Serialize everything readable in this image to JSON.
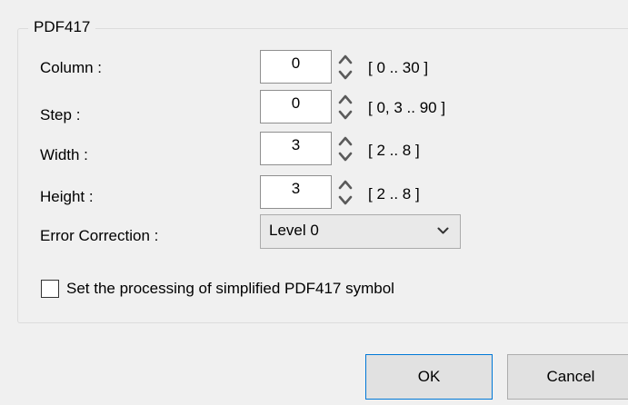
{
  "group": {
    "title": "PDF417"
  },
  "fields": {
    "column": {
      "label": "Column :",
      "value": "0",
      "range": "[ 0 .. 30 ]"
    },
    "step": {
      "label": "Step :",
      "value": "0",
      "range": "[ 0, 3 .. 90 ]"
    },
    "width": {
      "label": "Width :",
      "value": "3",
      "range": "[ 2 .. 8 ]"
    },
    "height": {
      "label": "Height :",
      "value": "3",
      "range": "[ 2 .. 8 ]"
    }
  },
  "error_correction": {
    "label": "Error Correction :",
    "selected": "Level 0"
  },
  "checkbox": {
    "label": "Set the processing of simplified PDF417 symbol",
    "checked": false
  },
  "buttons": {
    "ok": "OK",
    "cancel": "Cancel"
  },
  "colors": {
    "background": "#f0f0f0",
    "focus_border": "#0078d7",
    "spinner": "#5a5a5a"
  },
  "icons": {
    "spinner": "up-down-spin-arrows",
    "dropdown": "chevron-down"
  }
}
